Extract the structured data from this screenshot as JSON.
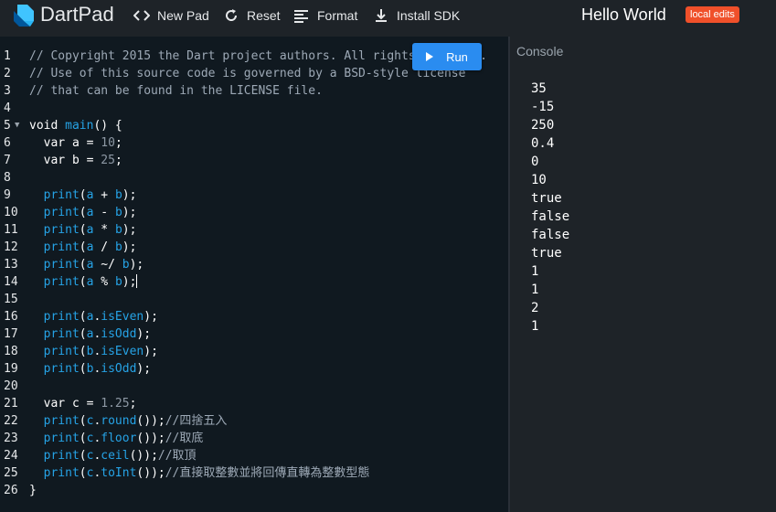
{
  "app": {
    "brand": "DartPad",
    "title": "Hello World",
    "badge": "local edits"
  },
  "toolbar": {
    "new_pad": "New Pad",
    "reset": "Reset",
    "format": "Format",
    "install_sdk": "Install SDK"
  },
  "editor": {
    "run_label": "Run",
    "lines": [
      {
        "n": "1",
        "fold": false,
        "tokens": [
          [
            "cm",
            "// Copyright 2015 the Dart project authors. All rights reserved."
          ]
        ]
      },
      {
        "n": "2",
        "fold": false,
        "tokens": [
          [
            "cm",
            "// Use of this source code is governed by a BSD-style license"
          ]
        ]
      },
      {
        "n": "3",
        "fold": false,
        "tokens": [
          [
            "cm",
            "// that can be found in the LICENSE file."
          ]
        ]
      },
      {
        "n": "4",
        "fold": false,
        "tokens": []
      },
      {
        "n": "5",
        "fold": true,
        "tokens": [
          [
            "kw",
            "void "
          ],
          [
            "fn",
            "main"
          ],
          [
            "pun",
            "() {"
          ]
        ]
      },
      {
        "n": "6",
        "fold": false,
        "tokens": [
          [
            "kw",
            "  var "
          ],
          [
            "var",
            "a"
          ],
          [
            "pun",
            " = "
          ],
          [
            "num",
            "10"
          ],
          [
            "pun",
            ";"
          ]
        ]
      },
      {
        "n": "7",
        "fold": false,
        "tokens": [
          [
            "kw",
            "  var "
          ],
          [
            "var",
            "b"
          ],
          [
            "pun",
            " = "
          ],
          [
            "num",
            "25"
          ],
          [
            "pun",
            ";"
          ]
        ]
      },
      {
        "n": "8",
        "fold": false,
        "tokens": []
      },
      {
        "n": "9",
        "fold": false,
        "tokens": [
          [
            "fn",
            "  print"
          ],
          [
            "pun",
            "("
          ],
          [
            "fn",
            "a"
          ],
          [
            "pun",
            " + "
          ],
          [
            "fn",
            "b"
          ],
          [
            "pun",
            ");"
          ]
        ]
      },
      {
        "n": "10",
        "fold": false,
        "tokens": [
          [
            "fn",
            "  print"
          ],
          [
            "pun",
            "("
          ],
          [
            "fn",
            "a"
          ],
          [
            "pun",
            " - "
          ],
          [
            "fn",
            "b"
          ],
          [
            "pun",
            ");"
          ]
        ]
      },
      {
        "n": "11",
        "fold": false,
        "tokens": [
          [
            "fn",
            "  print"
          ],
          [
            "pun",
            "("
          ],
          [
            "fn",
            "a"
          ],
          [
            "pun",
            " * "
          ],
          [
            "fn",
            "b"
          ],
          [
            "pun",
            ");"
          ]
        ]
      },
      {
        "n": "12",
        "fold": false,
        "tokens": [
          [
            "fn",
            "  print"
          ],
          [
            "pun",
            "("
          ],
          [
            "fn",
            "a"
          ],
          [
            "pun",
            " / "
          ],
          [
            "fn",
            "b"
          ],
          [
            "pun",
            ");"
          ]
        ]
      },
      {
        "n": "13",
        "fold": false,
        "tokens": [
          [
            "fn",
            "  print"
          ],
          [
            "pun",
            "("
          ],
          [
            "fn",
            "a"
          ],
          [
            "pun",
            " ~/ "
          ],
          [
            "fn",
            "b"
          ],
          [
            "pun",
            ");"
          ]
        ]
      },
      {
        "n": "14",
        "fold": false,
        "caret": true,
        "tokens": [
          [
            "fn",
            "  print"
          ],
          [
            "pun",
            "("
          ],
          [
            "fn",
            "a"
          ],
          [
            "pun",
            " % "
          ],
          [
            "fn",
            "b"
          ],
          [
            "pun",
            ");"
          ]
        ]
      },
      {
        "n": "15",
        "fold": false,
        "tokens": []
      },
      {
        "n": "16",
        "fold": false,
        "tokens": [
          [
            "fn",
            "  print"
          ],
          [
            "pun",
            "("
          ],
          [
            "fn",
            "a"
          ],
          [
            "pun",
            "."
          ],
          [
            "fn",
            "isEven"
          ],
          [
            "pun",
            ");"
          ]
        ]
      },
      {
        "n": "17",
        "fold": false,
        "tokens": [
          [
            "fn",
            "  print"
          ],
          [
            "pun",
            "("
          ],
          [
            "fn",
            "a"
          ],
          [
            "pun",
            "."
          ],
          [
            "fn",
            "isOdd"
          ],
          [
            "pun",
            ");"
          ]
        ]
      },
      {
        "n": "18",
        "fold": false,
        "tokens": [
          [
            "fn",
            "  print"
          ],
          [
            "pun",
            "("
          ],
          [
            "fn",
            "b"
          ],
          [
            "pun",
            "."
          ],
          [
            "fn",
            "isEven"
          ],
          [
            "pun",
            ");"
          ]
        ]
      },
      {
        "n": "19",
        "fold": false,
        "tokens": [
          [
            "fn",
            "  print"
          ],
          [
            "pun",
            "("
          ],
          [
            "fn",
            "b"
          ],
          [
            "pun",
            "."
          ],
          [
            "fn",
            "isOdd"
          ],
          [
            "pun",
            ");"
          ]
        ]
      },
      {
        "n": "20",
        "fold": false,
        "tokens": []
      },
      {
        "n": "21",
        "fold": false,
        "tokens": [
          [
            "kw",
            "  var "
          ],
          [
            "var",
            "c"
          ],
          [
            "pun",
            " = "
          ],
          [
            "num",
            "1.25"
          ],
          [
            "pun",
            ";"
          ]
        ]
      },
      {
        "n": "22",
        "fold": false,
        "tokens": [
          [
            "fn",
            "  print"
          ],
          [
            "pun",
            "("
          ],
          [
            "fn",
            "c"
          ],
          [
            "pun",
            "."
          ],
          [
            "fn",
            "round"
          ],
          [
            "pun",
            "());"
          ],
          [
            "cm",
            "//四捨五入"
          ]
        ]
      },
      {
        "n": "23",
        "fold": false,
        "tokens": [
          [
            "fn",
            "  print"
          ],
          [
            "pun",
            "("
          ],
          [
            "fn",
            "c"
          ],
          [
            "pun",
            "."
          ],
          [
            "fn",
            "floor"
          ],
          [
            "pun",
            "());"
          ],
          [
            "cm",
            "//取底"
          ]
        ]
      },
      {
        "n": "24",
        "fold": false,
        "tokens": [
          [
            "fn",
            "  print"
          ],
          [
            "pun",
            "("
          ],
          [
            "fn",
            "c"
          ],
          [
            "pun",
            "."
          ],
          [
            "fn",
            "ceil"
          ],
          [
            "pun",
            "());"
          ],
          [
            "cm",
            "//取頂"
          ]
        ]
      },
      {
        "n": "25",
        "fold": false,
        "tokens": [
          [
            "fn",
            "  print"
          ],
          [
            "pun",
            "("
          ],
          [
            "fn",
            "c"
          ],
          [
            "pun",
            "."
          ],
          [
            "fn",
            "toInt"
          ],
          [
            "pun",
            "());"
          ],
          [
            "cm",
            "//直接取整數並將回傳直轉為整數型態"
          ]
        ]
      },
      {
        "n": "26",
        "fold": false,
        "tokens": [
          [
            "pun",
            "}"
          ]
        ]
      }
    ]
  },
  "console": {
    "label": "Console",
    "output": [
      "35",
      "-15",
      "250",
      "0.4",
      "0",
      "10",
      "true",
      "false",
      "false",
      "true",
      "1",
      "1",
      "2",
      "1"
    ]
  },
  "colors": {
    "accent": "#2a8cf0",
    "badge": "#f0502a",
    "editor_bg": "#101920",
    "panel_bg": "#1e2328"
  }
}
